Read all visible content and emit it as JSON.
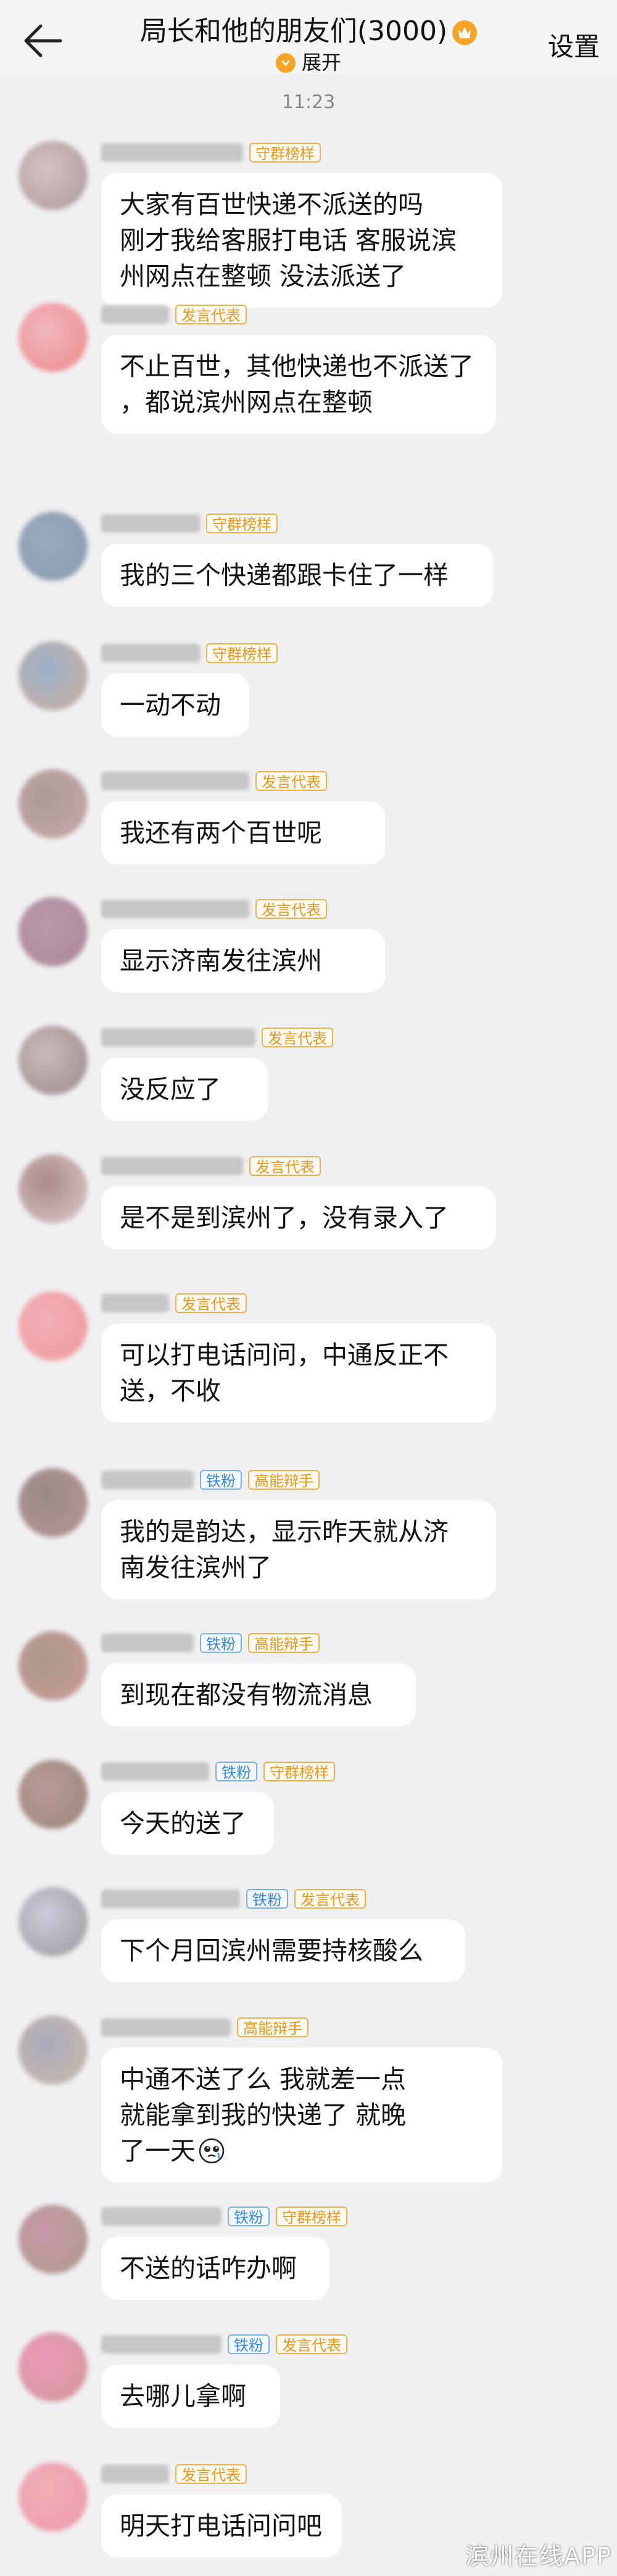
{
  "header": {
    "title": "局长和他的朋友们(3000)",
    "expand_label": "展开",
    "settings_label": "设置"
  },
  "timestamp": "11:23",
  "colors": {
    "gold": "#f4a528",
    "badge_gold": "#e9961d",
    "badge_blue": "#3c8ad5"
  },
  "messages": [
    {
      "badges": [
        "守群榜样"
      ],
      "text": "大家有百世快递不派送的吗刚才我给客服打电话 客服说滨州网点在整顿 没法派送了"
    },
    {
      "badges": [
        "发言代表"
      ],
      "text": "不止百世，其他快递也不派送了，都说滨州网点在整顿"
    },
    {
      "badges": [
        "守群榜样"
      ],
      "text": "我的三个快递都跟卡住了一样"
    },
    {
      "badges": [
        "守群榜样"
      ],
      "text": "一动不动"
    },
    {
      "badges": [
        "发言代表"
      ],
      "text": "我还有两个百世呢"
    },
    {
      "badges": [
        "发言代表"
      ],
      "text": "显示济南发往滨州"
    },
    {
      "badges": [
        "发言代表"
      ],
      "text": "没反应了"
    },
    {
      "badges": [
        "发言代表"
      ],
      "text": "是不是到滨州了，没有录入了"
    },
    {
      "badges": [
        "发言代表"
      ],
      "text": "可以打电话问问，中通反正不送，不收"
    },
    {
      "badges": [
        "铁粉",
        "高能辩手"
      ],
      "text": "我的是韵达，显示昨天就从济南发往滨州了"
    },
    {
      "badges": [
        "铁粉",
        "高能辩手"
      ],
      "text": "到现在都没有物流消息"
    },
    {
      "badges": [
        "铁粉",
        "守群榜样"
      ],
      "text": "今天的送了"
    },
    {
      "badges": [
        "铁粉",
        "发言代表"
      ],
      "text": "下个月回滨州需要持核酸么"
    },
    {
      "badges": [
        "高能辩手"
      ],
      "text": "中通不送了么 我就差一点就能拿到我的快递了 就晚了一天"
    },
    {
      "badges": [
        "铁粉",
        "守群榜样"
      ],
      "text": "不送的话咋办啊"
    },
    {
      "badges": [
        "铁粉",
        "发言代表"
      ],
      "text": "去哪儿拿啊"
    },
    {
      "badges": [
        "发言代表"
      ],
      "text": "明天打电话问问吧"
    }
  ],
  "watermark": "滨州在线APP"
}
